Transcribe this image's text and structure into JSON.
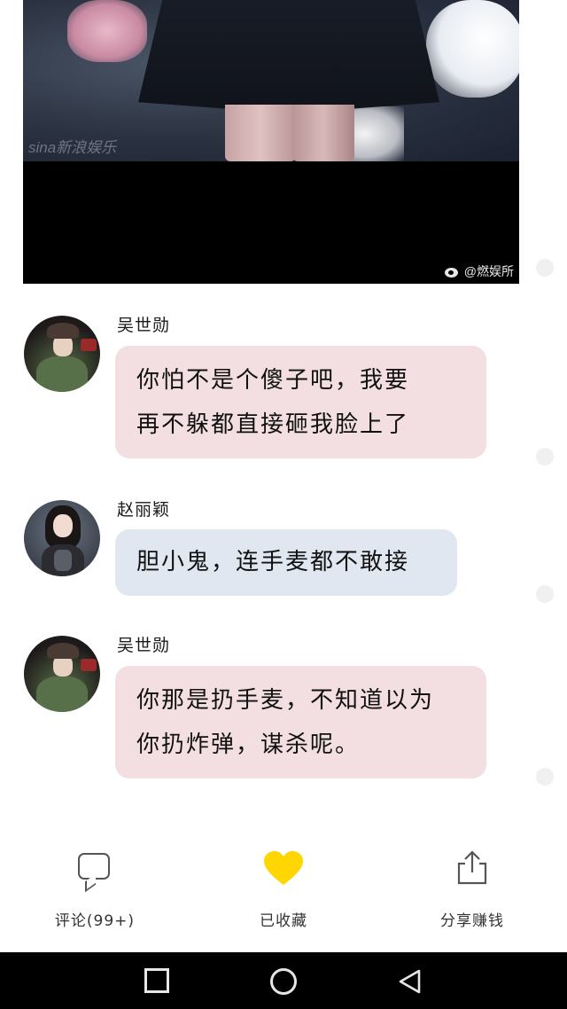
{
  "photo": {
    "watermark_small": "sina新浪娱乐",
    "watermark": "@燃娱所",
    "watermark_icon": "weibo-icon"
  },
  "messages": [
    {
      "sender": "吴世勋",
      "avatar": "avatar-wu-shixun",
      "bubble_color": "#f3dfe1",
      "lines": [
        "你怕不是个傻子吧，我要",
        "再不躲都直接砸我脸上了"
      ]
    },
    {
      "sender": "赵丽颖",
      "avatar": "avatar-zhao-liying",
      "bubble_color": "#e0e7f0",
      "lines": [
        "胆小鬼，连手麦都不敢接"
      ]
    },
    {
      "sender": "吴世勋",
      "avatar": "avatar-wu-shixun",
      "bubble_color": "#f3dfe1",
      "lines": [
        "你那是扔手麦，不知道以为",
        "你扔炸弹，谋杀呢。"
      ]
    }
  ],
  "actions": {
    "comment": {
      "label": "评论(99+)",
      "icon": "comment-icon"
    },
    "favorite": {
      "label": "已收藏",
      "icon": "heart-icon",
      "color": "#ffd600",
      "state": "favorited"
    },
    "share": {
      "label": "分享赚钱",
      "icon": "share-icon"
    }
  },
  "system_nav": {
    "recent": "recent-apps-icon",
    "home": "home-icon",
    "back": "back-icon"
  }
}
